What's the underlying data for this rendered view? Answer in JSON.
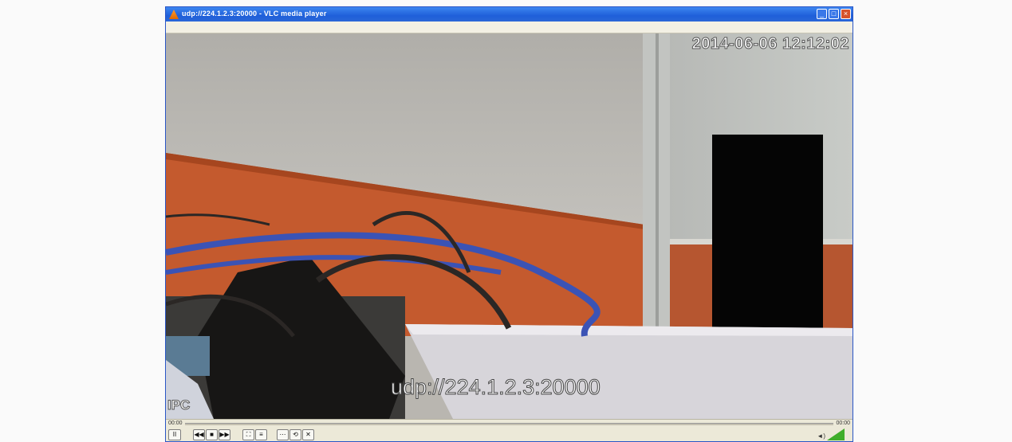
{
  "window": {
    "title": "udp://224.1.2.3:20000 - VLC media player",
    "minimize_label": "_",
    "maximize_label": "□",
    "close_label": "×"
  },
  "video": {
    "timestamp_overlay": "2014-06-06 12:12:02",
    "stream_overlay": "udp://224.1.2.3:20000",
    "camera_label": "IPC"
  },
  "controls": {
    "elapsed": "00:00",
    "remaining": "00:00",
    "buttons": {
      "pause": "II",
      "prev": "◀◀",
      "stop": "■",
      "next": "▶▶",
      "fullscreen": "⛶",
      "playlist": "≡",
      "extended": "⋯",
      "loop": "⟲",
      "shuffle": "✕"
    },
    "volume_icon": "speaker-icon",
    "volume_level": 1.0
  },
  "colors": {
    "accent": "#1f5fd9",
    "wall_orange": "#c45a2e",
    "volume_green": "#3fae2a"
  }
}
